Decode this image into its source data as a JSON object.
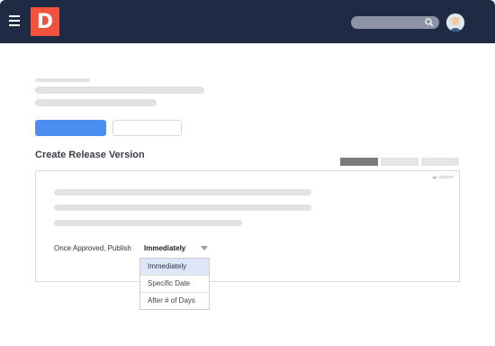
{
  "header": {
    "logo_letter": "D",
    "menu_icon": "hamburger-icon",
    "search_icon": "search-icon",
    "avatar_icon": "user-avatar-icon",
    "brand_color": "#f0523d",
    "bar_color": "#1f2a44"
  },
  "main": {
    "section_title": "Create Release Version",
    "options_label": "options",
    "field_label": "Once Approved, Publish",
    "selected_value": "Immediately",
    "dropdown_options": [
      "Immediately",
      "Specific Date",
      "After # of Days"
    ],
    "primary_button_color": "#4b8ef1"
  }
}
